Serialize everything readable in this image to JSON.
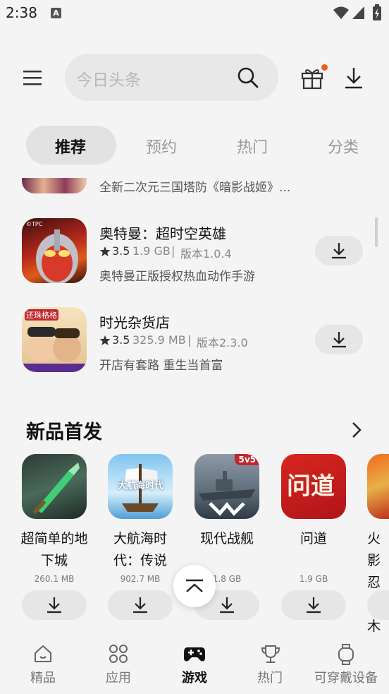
{
  "status_bar": {
    "time": "2:38",
    "notification_letter": "A"
  },
  "header": {
    "search_placeholder": "今日头条"
  },
  "tabs": [
    {
      "label": "推荐"
    },
    {
      "label": "预约"
    },
    {
      "label": "热门"
    },
    {
      "label": "分类"
    }
  ],
  "partial_game": {
    "description": "全新二次元三国塔防《暗影战姬》..."
  },
  "games": [
    {
      "title": "奥特曼：超时空英雄",
      "rating": "3.5",
      "size": "1.9 GB",
      "version": "版本1.0.4",
      "description": "奥特曼正版授权热血动作手游",
      "icon_text": "©TPC"
    },
    {
      "title": "时光杂货店",
      "rating": "3.5",
      "size": "325.9 MB",
      "version": "版本2.3.0",
      "description": "开店有套路 重生当首富",
      "icon_text": "还珠格格"
    }
  ],
  "new_releases": {
    "title": "新品首发",
    "items": [
      {
        "name": "超简单的地下城",
        "size": "260.1 MB"
      },
      {
        "name": "大航海时代：传说",
        "size": "902.7 MB",
        "icon_text": "大航海时代"
      },
      {
        "name": "现代战舰",
        "size": "1.8 GB",
        "icon_text": "5v5"
      },
      {
        "name": "问道",
        "size": "1.9 GB",
        "icon_text": "问道"
      },
      {
        "name": "火影忍者木叶",
        "size": ""
      }
    ]
  },
  "bottom_nav": [
    {
      "label": "精品"
    },
    {
      "label": "应用"
    },
    {
      "label": "游戏"
    },
    {
      "label": "热门"
    },
    {
      "label": "可穿戴设备"
    }
  ],
  "colors": {
    "accent_dot": "#f15a24",
    "pill": "#e2e2e2",
    "background": "#f4f4f4"
  }
}
